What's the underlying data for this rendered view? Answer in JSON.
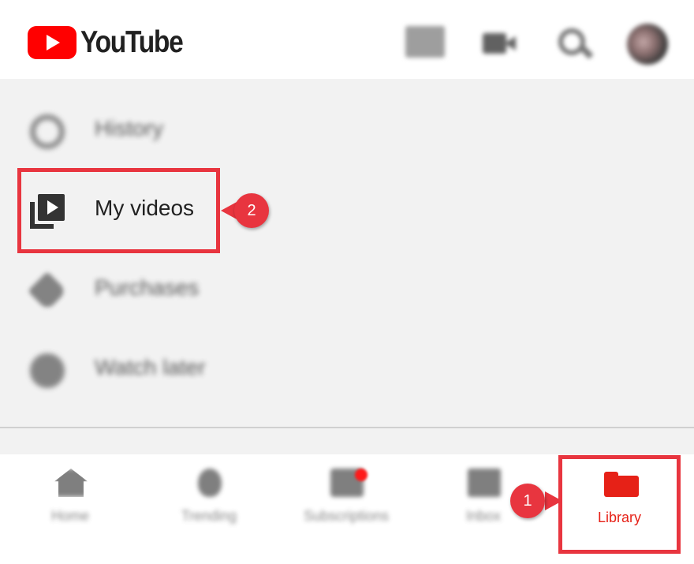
{
  "app": {
    "name": "YouTube"
  },
  "header": {
    "logo_text": "YouTube",
    "icons": [
      "cast-icon",
      "video-camera-icon",
      "search-icon",
      "avatar"
    ]
  },
  "menu": {
    "items": [
      {
        "label": "History",
        "icon": "history-icon",
        "blurred": true
      },
      {
        "label": "My videos",
        "icon": "my-videos-icon",
        "blurred": false
      },
      {
        "label": "Purchases",
        "icon": "tag-icon",
        "blurred": true
      },
      {
        "label": "Watch later",
        "icon": "clock-icon",
        "blurred": true
      }
    ]
  },
  "bottom_nav": {
    "items": [
      {
        "label": "Home",
        "icon": "home-icon"
      },
      {
        "label": "Trending",
        "icon": "flame-icon"
      },
      {
        "label": "Subscriptions",
        "icon": "subscriptions-icon"
      },
      {
        "label": "Inbox",
        "icon": "inbox-icon"
      },
      {
        "label": "Library",
        "icon": "folder-icon",
        "active": true
      }
    ]
  },
  "annotations": {
    "step_1": "1",
    "step_2": "2"
  },
  "colors": {
    "brand_red": "#ff0000",
    "active_red": "#e62117",
    "highlight_red": "#e8353f",
    "menu_bg": "#f2f2f2"
  }
}
